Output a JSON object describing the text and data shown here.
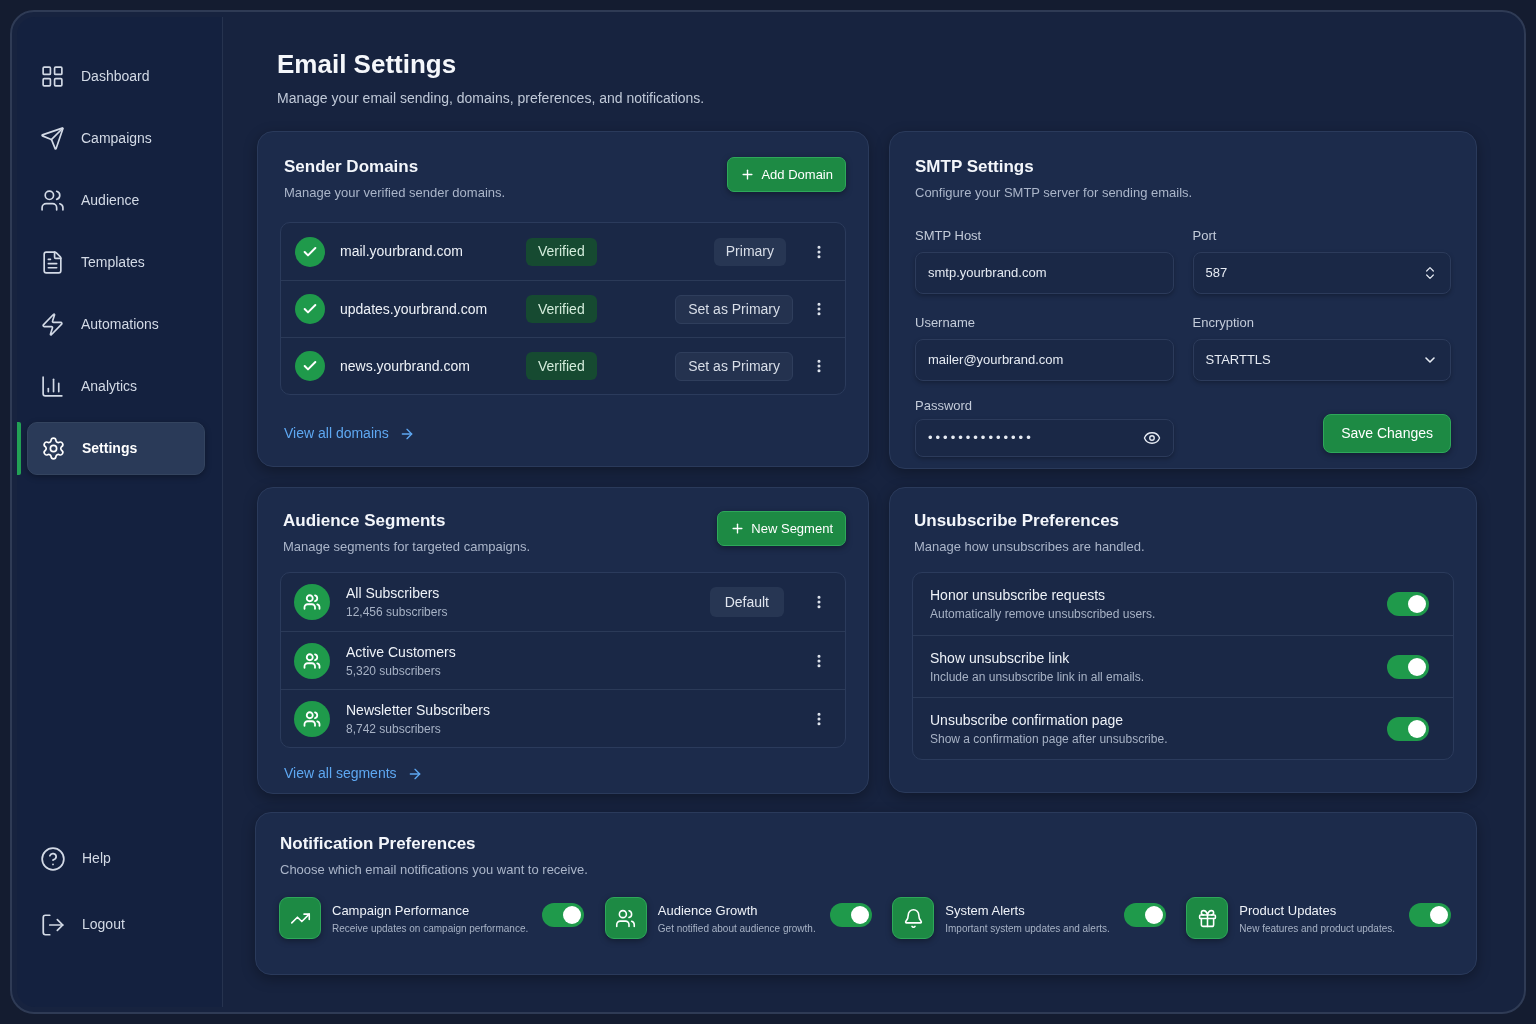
{
  "sidebar": {
    "nav_items": [
      {
        "label": "Dashboard",
        "selected": false
      },
      {
        "label": "Campaigns",
        "selected": false
      },
      {
        "label": "Audience",
        "selected": false
      },
      {
        "label": "Templates",
        "selected": false
      },
      {
        "label": "Automations",
        "selected": false
      },
      {
        "label": "Analytics",
        "selected": false
      },
      {
        "label": "Settings",
        "selected": true
      }
    ],
    "footer_items": [
      {
        "label": "Help"
      },
      {
        "label": "Logout"
      }
    ]
  },
  "header": {
    "title": "Email Settings",
    "subtitle": "Manage your email sending, domains, preferences, and notifications."
  },
  "sender_domains": {
    "title": "Sender Domains",
    "subtitle": "Manage your verified sender domains.",
    "add_button": "Add Domain",
    "domains": [
      {
        "name": "mail.yourbrand.com",
        "status": "Verified",
        "primary": true,
        "action": "Primary"
      },
      {
        "name": "updates.yourbrand.com",
        "status": "Verified",
        "primary": false,
        "action": "Set as Primary"
      },
      {
        "name": "news.yourbrand.com",
        "status": "Verified",
        "primary": false,
        "action": "Set as Primary"
      }
    ],
    "link": "View all domains"
  },
  "smtp": {
    "title": "SMTP Settings",
    "subtitle": "Configure your SMTP server for sending emails.",
    "host": {
      "label": "SMTP Host",
      "value": "smtp.yourbrand.com"
    },
    "port": {
      "label": "Port",
      "value": "587"
    },
    "username": {
      "label": "Username",
      "value": "mailer@yourbrand.com"
    },
    "encryption": {
      "label": "Encryption",
      "value": "STARTTLS"
    },
    "password": {
      "label": "Password",
      "value": "••••••••••••••"
    },
    "save_button": "Save Changes"
  },
  "audience_segments": {
    "title": "Audience Segments",
    "subtitle": "Manage segments for targeted campaigns.",
    "new_button": "New Segment",
    "segments": [
      {
        "name": "All Subscribers",
        "count": "12,456 subscribers",
        "badge": "Default"
      },
      {
        "name": "Active Customers",
        "count": "5,320 subscribers"
      },
      {
        "name": "Newsletter Subscribers",
        "count": "8,742 subscribers"
      }
    ],
    "link": "View all segments"
  },
  "unsubscribe": {
    "title": "Unsubscribe Preferences",
    "subtitle": "Manage how unsubscribes are handled.",
    "options": [
      {
        "title": "Honor unsubscribe requests",
        "description": "Automatically remove unsubscribed users.",
        "on": true
      },
      {
        "title": "Show unsubscribe link",
        "description": "Include an unsubscribe link in all emails.",
        "on": true
      },
      {
        "title": "Unsubscribe confirmation page",
        "description": "Show a confirmation page after unsubscribe.",
        "on": true
      }
    ]
  },
  "notifications": {
    "title": "Notification Preferences",
    "subtitle": "Choose which email notifications you want to receive.",
    "items": [
      {
        "title": "Campaign Performance",
        "description": "Receive updates on campaign performance.",
        "on": true
      },
      {
        "title": "Audience Growth",
        "description": "Get notified about audience growth.",
        "on": true
      },
      {
        "title": "System Alerts",
        "description": "Important system updates and alerts.",
        "on": true
      },
      {
        "title": "Product Updates",
        "description": "New features and product updates.",
        "on": true
      }
    ]
  }
}
